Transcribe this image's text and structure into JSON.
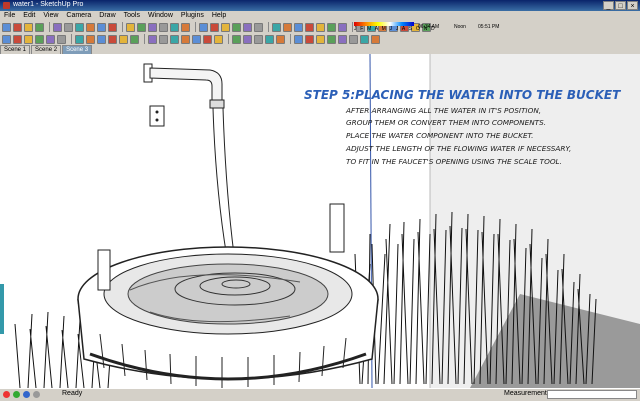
{
  "window": {
    "title": "water1 - SketchUp Pro",
    "buttons": [
      "_",
      "□",
      "×"
    ]
  },
  "menu": [
    "File",
    "Edit",
    "View",
    "Camera",
    "Draw",
    "Tools",
    "Window",
    "Plugins",
    "Help"
  ],
  "shadow": {
    "months": "J F M A M J J A S O N D",
    "time_start": "06:34 AM",
    "noon": "Noon",
    "time_end": "05:51 PM"
  },
  "scenes": [
    {
      "label": "Scene 1",
      "active": false
    },
    {
      "label": "Scene 2",
      "active": false
    },
    {
      "label": "Scene 3",
      "active": true
    }
  ],
  "overlay": {
    "title": "STEP 5:PLACING THE WATER INTO THE BUCKET",
    "lines": [
      "AFTER ARRANGING ALL THE WATER IN IT'S POSITION,",
      "GROUP THEM OR CONVERT THEM INTO COMPONENTS.",
      "PLACE THE WATER COMPONENT INTO THE BUCKET.",
      "ADJUST THE LENGTH OF THE FLOWING WATER IF NECESSARY,",
      "TO FIT IN THE FAUCET'S OPENING USING THE SCALE TOOL."
    ]
  },
  "status": {
    "text": "Ready",
    "measurements_label": "Measurements",
    "measurements_value": ""
  },
  "icons": {
    "toolbar1": [
      "select-icon",
      "component-icon",
      "paint-icon",
      "eraser-icon",
      "rectangle-icon",
      "line-icon",
      "circle-icon",
      "arc-icon",
      "polygon-icon",
      "freehand-icon",
      "move-icon",
      "pushpull-icon",
      "rotate-icon",
      "followme-icon",
      "scale-icon",
      "offset-icon",
      "tape-icon",
      "dimension-icon",
      "protractor-icon",
      "text-icon",
      "axes-icon",
      "3dtext-icon",
      "orbit-icon",
      "pan-icon",
      "zoom-icon",
      "zoom-window-icon",
      "zoom-extents-icon",
      "prev-view-icon",
      "next-view-icon",
      "walk-icon",
      "lookaround-icon",
      "position-camera-icon",
      "section-icon",
      "display-section-icon",
      "shadow-toggle-icon",
      "fog-icon"
    ],
    "toolbar2": [
      "iso-icon",
      "top-icon",
      "front-icon",
      "right-icon",
      "back-icon",
      "left-icon",
      "xray-icon",
      "wireframe-icon",
      "hiddenline-icon",
      "shaded-icon",
      "textured-icon",
      "monochrome-icon",
      "sandbox-from-contours-icon",
      "sandbox-from-scratch-icon",
      "smoove-icon",
      "stamp-icon",
      "drape-icon",
      "add-detail-icon",
      "flip-edge-icon",
      "layer-icon",
      "warehouse-icon",
      "share-model-icon",
      "component-share-icon",
      "extension-icon",
      "plugin-a-icon",
      "plugin-b-icon",
      "plugin-c-icon",
      "plugin-d-icon",
      "plugin-e-icon",
      "plugin-f-icon",
      "plugin-g-icon",
      "plugin-h-icon"
    ]
  }
}
